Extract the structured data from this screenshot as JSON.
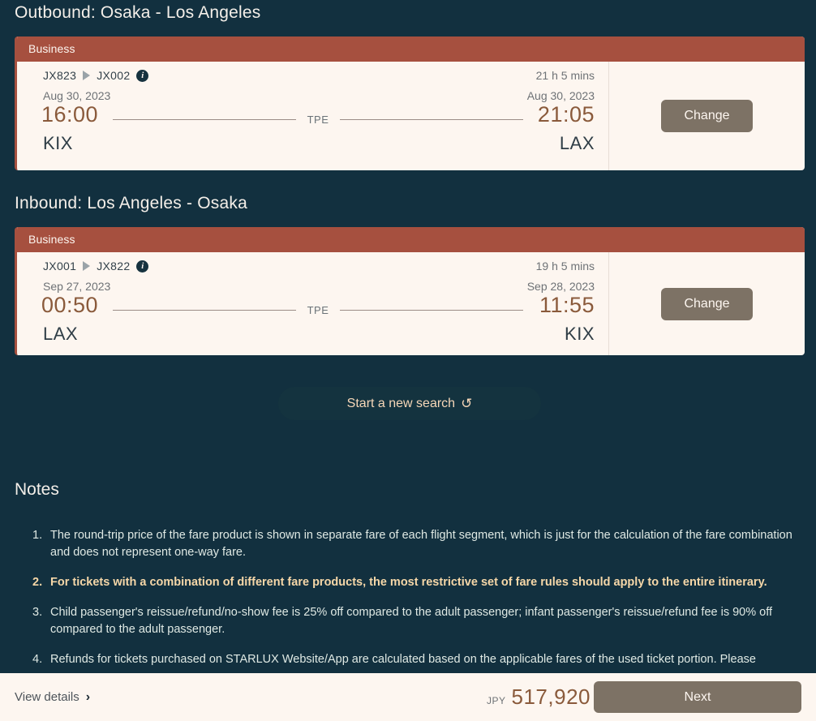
{
  "outbound": {
    "title": "Outbound: Osaka - Los Angeles",
    "cabin": "Business",
    "flight_first": "JX823",
    "flight_second": "JX002",
    "info_icon": "i",
    "depart_date": "Aug 30, 2023",
    "arrive_date": "Aug 30, 2023",
    "duration": "21 h 5 mins",
    "depart_time": "16:00",
    "arrive_time": "21:05",
    "depart_airport": "KIX",
    "arrive_airport": "LAX",
    "stop": "TPE",
    "change_label": "Change"
  },
  "inbound": {
    "title": "Inbound: Los Angeles - Osaka",
    "cabin": "Business",
    "flight_first": "JX001",
    "flight_second": "JX822",
    "info_icon": "i",
    "depart_date": "Sep 27, 2023",
    "arrive_date": "Sep 28, 2023",
    "duration": "19 h 5 mins",
    "depart_time": "00:50",
    "arrive_time": "11:55",
    "depart_airport": "LAX",
    "arrive_airport": "KIX",
    "stop": "TPE",
    "change_label": "Change"
  },
  "new_search": {
    "label": "Start a new search",
    "icon": "↺"
  },
  "notes": {
    "title": "Notes",
    "items": [
      {
        "text": "The round-trip price of the fare product is shown in separate fare of each flight segment, which is just for the calculation of the fare combination and does not represent one-way fare.",
        "highlight": false
      },
      {
        "text": "For tickets with a combination of different fare products, the most restrictive set of fare rules should apply to the entire itinerary.",
        "highlight": true
      },
      {
        "text": "Child passenger's reissue/refund/no-show fee is 25% off compared to the adult passenger; infant passenger's reissue/refund fee is 90% off compared to the adult passenger.",
        "highlight": false
      },
      {
        "text": "Refunds for tickets purchased on STARLUX Website/App are calculated based on the applicable fares of the used ticket portion. Please",
        "highlight": false
      }
    ]
  },
  "footer": {
    "view_details_label": "View details",
    "chevron_icon": "›",
    "currency": "JPY",
    "amount": "517,920",
    "next_label": "Next"
  },
  "colors": {
    "page_background": "#12303f",
    "card_background": "#fdf6f0",
    "cabin_header": "#a6503f",
    "accent_time": "#8a5a3b",
    "button_brown": "#7d7265",
    "highlight_note": "#f6d7a8"
  }
}
